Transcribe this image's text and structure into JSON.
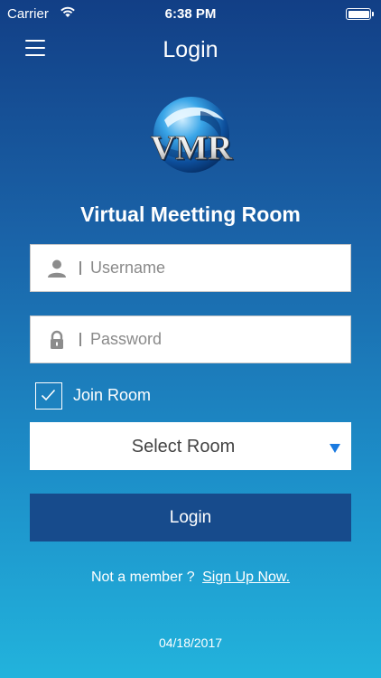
{
  "status_bar": {
    "carrier": "Carrier",
    "time": "6:38 PM",
    "battery_level": 1.0
  },
  "nav": {
    "title": "Login",
    "menu_icon": "hamburger-menu-icon"
  },
  "logo": {
    "text": "VMR"
  },
  "app_name": "Virtual Meetting Room",
  "username_field": {
    "placeholder": "Username",
    "value": "",
    "icon": "user-icon"
  },
  "password_field": {
    "placeholder": "Password",
    "value": "",
    "icon": "lock-icon"
  },
  "join_room": {
    "label": "Join Room",
    "checked": true
  },
  "room_select": {
    "selected": "Select Room"
  },
  "login_button": {
    "label": "Login"
  },
  "signup": {
    "prompt": "Not a member ?",
    "link": "Sign Up Now."
  },
  "footer": {
    "date": "04/18/2017"
  },
  "colors": {
    "gradient_top": "#123f86",
    "gradient_bottom": "#22b3dc",
    "login_button_bg": "#174b8c",
    "dropdown_arrow": "#1a7ae0"
  }
}
